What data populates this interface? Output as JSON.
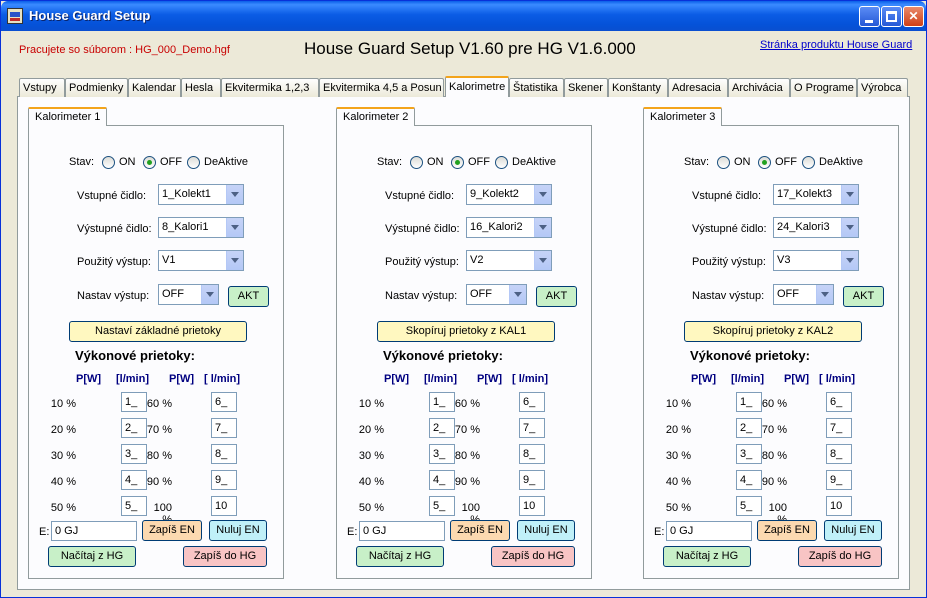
{
  "window": {
    "title": "House Guard Setup"
  },
  "header": {
    "file_label": "Pracujete so súborom : HG_000_Demo.hgf",
    "app_heading": "House Guard Setup V1.60 pre HG V1.6.000",
    "product_link": "Stránka produktu House Guard"
  },
  "tabs": [
    {
      "label": "Vstupy"
    },
    {
      "label": "Podmienky"
    },
    {
      "label": "Kalendar"
    },
    {
      "label": "Hesla"
    },
    {
      "label": "Ekvitermika 1,2,3"
    },
    {
      "label": "Ekvitermika 4,5 a Posun"
    },
    {
      "label": "Kalorimetre"
    },
    {
      "label": "Štatistika"
    },
    {
      "label": "Skener"
    },
    {
      "label": "Konštanty"
    },
    {
      "label": "Adresacia"
    },
    {
      "label": "Archivácia"
    },
    {
      "label": "O Programe"
    },
    {
      "label": "Výrobca"
    }
  ],
  "labels": {
    "stav": "Stav:",
    "on": "ON",
    "off": "OFF",
    "deaktive": "DeAktive",
    "vstupne": "Vstupné čidlo:",
    "vystupne": "Výstupné čidlo:",
    "pouzity": "Použitý výstup:",
    "nastav": "Nastav výstup:",
    "akt": "AKT",
    "vykonove": "Výkonové prietoky:",
    "pw": "P[W]",
    "lmin1": "[l/min]",
    "lmin2": "[ l/min]",
    "e": "E:",
    "zapis_en": "Zapíš EN",
    "nuluj_en": "Nuluj EN",
    "nacitaj": "Načítaj z HG",
    "zapis_hg": "Zapíš do HG"
  },
  "calorimeters": [
    {
      "tab": "Kalorimeter 1",
      "state": "OFF",
      "input_sensor": "1_Kolekt1",
      "output_sensor": "8_Kalori1",
      "used_output": "V1",
      "set_output": "OFF",
      "action_button": "Nastaví základné prietoky",
      "left_pct": [
        "10 %",
        "20 %",
        "30 %",
        "40 %",
        "50 %"
      ],
      "left_vals": [
        "1_",
        "2_",
        "3_",
        "4_",
        "5_"
      ],
      "right_pct": [
        "60 %",
        "70 %",
        "80 %",
        "90 %",
        "100 %"
      ],
      "right_vals": [
        "6_",
        "7_",
        "8_",
        "9_",
        "10"
      ],
      "energy": "0 GJ"
    },
    {
      "tab": "Kalorimeter 2",
      "state": "OFF",
      "input_sensor": "9_Kolekt2",
      "output_sensor": "16_Kalori2",
      "used_output": "V2",
      "set_output": "OFF",
      "action_button": "Skopíruj prietoky z KAL1",
      "left_pct": [
        "10 %",
        "20 %",
        "30 %",
        "40 %",
        "50 %"
      ],
      "left_vals": [
        "1_",
        "2_",
        "3_",
        "4_",
        "5_"
      ],
      "right_pct": [
        "60 %",
        "70 %",
        "80 %",
        "90 %",
        "100 %"
      ],
      "right_vals": [
        "6_",
        "7_",
        "8_",
        "9_",
        "10"
      ],
      "energy": "0 GJ"
    },
    {
      "tab": "Kalorimeter 3",
      "state": "OFF",
      "input_sensor": "17_Kolekt3",
      "output_sensor": "24_Kalori3",
      "used_output": "V3",
      "set_output": "OFF",
      "action_button": "Skopíruj prietoky z KAL2",
      "left_pct": [
        "10 %",
        "20 %",
        "30 %",
        "40 %",
        "50 %"
      ],
      "left_vals": [
        "1_",
        "2_",
        "3_",
        "4_",
        "5_"
      ],
      "right_pct": [
        "60 %",
        "70 %",
        "80 %",
        "90 %",
        "100 %"
      ],
      "right_vals": [
        "6_",
        "7_",
        "8_",
        "9_",
        "10"
      ],
      "energy": "0 GJ"
    }
  ]
}
